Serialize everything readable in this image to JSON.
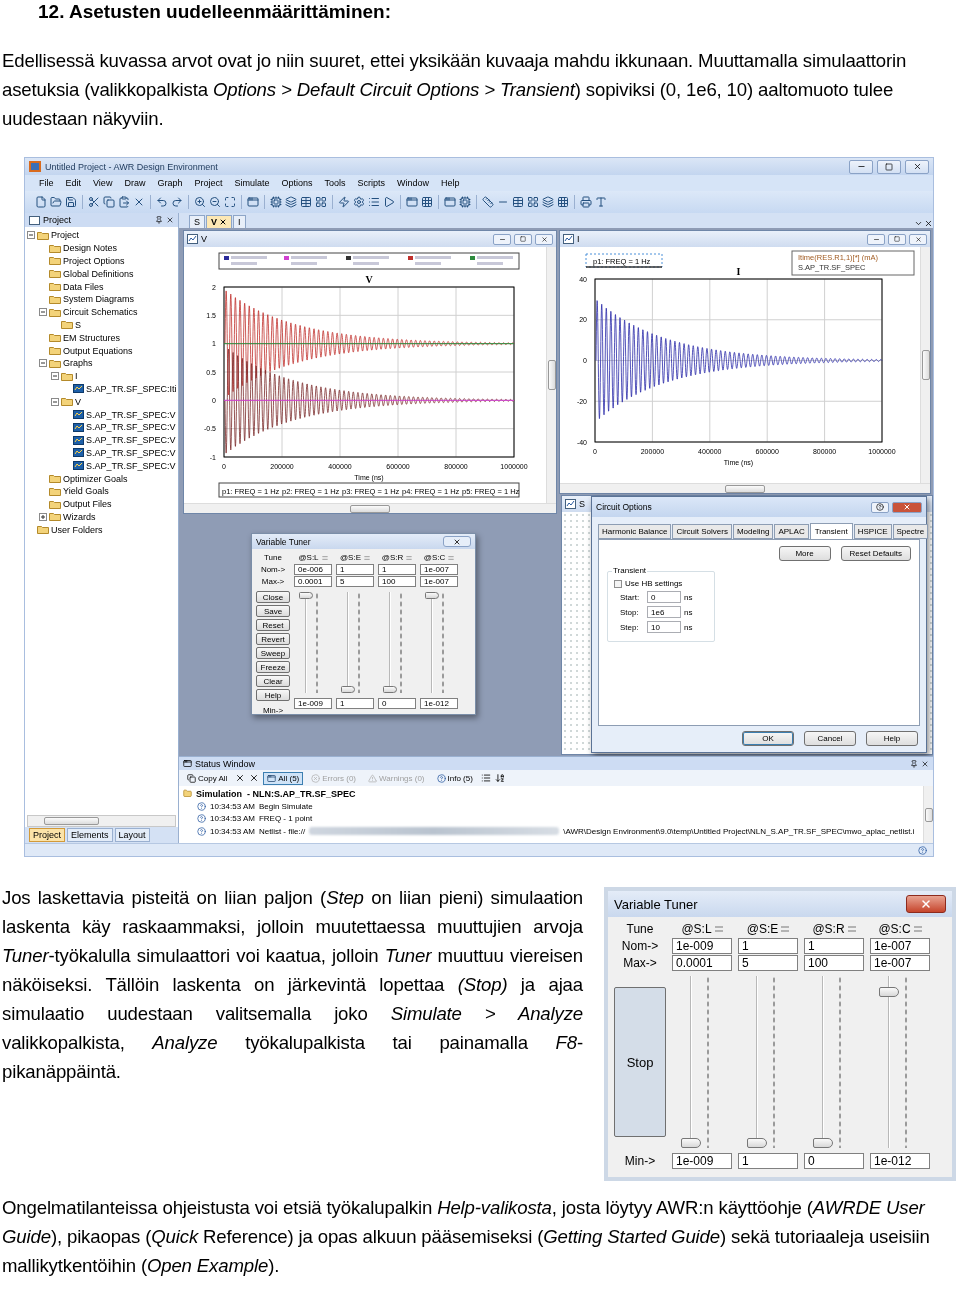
{
  "heading": "12. Asetusten uudelleenmäärittäminen:",
  "intro": "Edellisessä kuvassa arvot ovat jo niin suuret, ettei yksikään kuvaaja mahdu ikkunaan. Muuttamalla simulaattorin asetuksia (valikkopalkista *Options > Default Circuit Options > Transient*) sopiviksi (0, 1e6, 10) aaltomuoto tulee uudestaan näkyviin.",
  "app": {
    "title": "Untitled Project - AWR Design Environment",
    "menu": [
      "File",
      "Edit",
      "View",
      "Draw",
      "Graph",
      "Project",
      "Simulate",
      "Options",
      "Tools",
      "Scripts",
      "Window",
      "Help"
    ],
    "project_pane": {
      "title": "Project",
      "tree": [
        {
          "label": "Project",
          "expanded": true,
          "children": [
            {
              "label": "Design Notes"
            },
            {
              "label": "Project Options"
            },
            {
              "label": "Global Definitions"
            },
            {
              "label": "Data Files"
            },
            {
              "label": "System Diagrams"
            },
            {
              "label": "Circuit Schematics",
              "expanded": true,
              "children": [
                {
                  "label": "S"
                }
              ]
            },
            {
              "label": "EM Structures"
            },
            {
              "label": "Output Equations"
            },
            {
              "label": "Graphs",
              "expanded": true,
              "children": [
                {
                  "label": "I",
                  "expanded": true,
                  "children": [
                    {
                      "label": "S.AP_TR.SF_SPEC:Iti"
                    }
                  ]
                },
                {
                  "label": "V",
                  "expanded": true,
                  "children": [
                    {
                      "label": "S.AP_TR.SF_SPEC:V"
                    },
                    {
                      "label": "S.AP_TR.SF_SPEC:V"
                    },
                    {
                      "label": "S.AP_TR.SF_SPEC:V"
                    },
                    {
                      "label": "S.AP_TR.SF_SPEC:V"
                    },
                    {
                      "label": "S.AP_TR.SF_SPEC:V"
                    }
                  ]
                }
              ]
            },
            {
              "label": "Optimizer Goals"
            },
            {
              "label": "Yield Goals"
            },
            {
              "label": "Output Files"
            },
            {
              "label": "Wizards",
              "expanded": false
            }
          ]
        },
        {
          "label": "User Folders"
        }
      ],
      "tabs": [
        {
          "label": "Project",
          "selected": true
        },
        {
          "label": "Elements",
          "selected": false
        },
        {
          "label": "Layout",
          "selected": false
        }
      ]
    },
    "document_tabs": [
      {
        "label": "S",
        "selected": false
      },
      {
        "label": "V",
        "selected": true
      },
      {
        "label": "I",
        "selected": false
      }
    ],
    "graphs": [
      {
        "kind": "multi",
        "window_title": "V",
        "title": "V",
        "y_ticks": [
          "2",
          "1.5",
          "1",
          "0.5",
          "0",
          "-0.5",
          "-1"
        ],
        "x_ticks": [
          "0",
          "200000",
          "400000",
          "600000",
          "800000",
          "1000000"
        ],
        "x_label": "Time (ns)",
        "markers": [
          "p1: FREQ = 1 Hz",
          "p2: FREQ = 1 Hz",
          "p3: FREQ = 1 Hz",
          "p4: FREQ = 1 Hz",
          "p5: FREQ = 1 Hz"
        ]
      },
      {
        "kind": "single",
        "window_title": "I",
        "title": "I",
        "y_ticks": [
          "40",
          "20",
          "0",
          "-20",
          "-40"
        ],
        "x_ticks": [
          "0",
          "200000",
          "400000",
          "600000",
          "800000",
          "1000000"
        ],
        "x_label": "Time (ns)",
        "markers": [
          "p1: FREQ = 1 Hz"
        ],
        "legend": [
          "Itime(RES.R1,1)[*] (mA)",
          "S.AP_TR.SF_SPEC"
        ]
      }
    ],
    "schematic_window": {
      "title": "S"
    },
    "circuit_options": {
      "title": "Circuit Options",
      "tabs": [
        {
          "label": "Harmonic Balance",
          "selected": false
        },
        {
          "label": "Circuit Solvers",
          "selected": false
        },
        {
          "label": "Modeling",
          "selected": false
        },
        {
          "label": "APLAC",
          "selected": false
        },
        {
          "label": "Transient",
          "selected": true
        },
        {
          "label": "HSPICE",
          "selected": false
        },
        {
          "label": "Spectre",
          "selected": false
        }
      ],
      "more": "More",
      "reset": "Reset Defaults",
      "group": "Transient",
      "use_hb_settings": {
        "label": "Use HB settings",
        "checked": false
      },
      "fields": [
        {
          "label": "Start:",
          "value": "0",
          "unit": "ns"
        },
        {
          "label": "Stop:",
          "value": "1e6",
          "unit": "ns"
        },
        {
          "label": "Step:",
          "value": "10",
          "unit": "ns"
        }
      ],
      "buttons": [
        "OK",
        "Cancel",
        "Help"
      ]
    },
    "tuner": {
      "title": "Variable Tuner",
      "labels": [
        "Tune",
        "Nom->",
        "Max->",
        "Min->"
      ],
      "buttons": [
        "Close",
        "Save",
        "Reset",
        "Revert",
        "Sweep",
        "Freeze",
        "Clear",
        "Help"
      ],
      "vars": [
        {
          "name": "@S:L",
          "nom": "0e-006",
          "max": "0.0001",
          "min": "1e-009",
          "level": 1
        },
        {
          "name": "@S:E",
          "nom": "1",
          "max": "5",
          "min": "1",
          "level": 0
        },
        {
          "name": "@S:R",
          "nom": "1",
          "max": "100",
          "min": "0",
          "level": 0
        },
        {
          "name": "@S:C",
          "nom": "1e-007",
          "max": "1e-007",
          "min": "1e-012",
          "level": 1
        }
      ]
    },
    "status_window": {
      "title": "Status Window",
      "copy_all": "Copy All",
      "filters": [
        {
          "label": "All (5)",
          "selected": true,
          "disabled": false
        },
        {
          "label": "Errors (0)",
          "selected": false,
          "disabled": true
        },
        {
          "label": "Warnings (0)",
          "selected": false,
          "disabled": true
        },
        {
          "label": "Info (5)",
          "selected": false,
          "disabled": false
        }
      ],
      "group": "Simulation  - NLN:S.AP_TR.SF_SPEC",
      "entries": [
        {
          "time": "10:34:53 AM",
          "message": "Begin Simulate",
          "redacted": false
        },
        {
          "time": "10:34:53 AM",
          "message": "FREQ - 1 point",
          "redacted": false
        },
        {
          "time": "10:34:53 AM",
          "message": "Netlist - file://",
          "redacted": true,
          "message_end": "\\AWR\\Design Environment\\9.0\\temp\\Untitled Project\\NLN_S.AP_TR.SF_SPEC\\mwo_aplac_netlist.i"
        }
      ]
    }
  },
  "paragraph_2": "Jos laskettavia pisteitä on liian paljon (*Step* on liian pieni) simulaation laskenta käy raskaammaksi, jolloin muutettaessa muuttujien arvoja *Tuner*-työkalulla simulaattori voi kaatua, jolloin *Tuner* muuttuu viereisen näköiseksi. Tällöin laskenta on järkevintä lopettaa *(Stop)* ja ajaa simulaatio uudestaan valitsemalla joko *Simulate > Analyze* valikkopalkista, *Analyze* työkalupalkista tai painamalla *F8*-pikanäppäintä.",
  "tuner_2": {
    "title": "Variable Tuner",
    "labels": [
      "Tune",
      "Nom->",
      "Max->",
      "Min->"
    ],
    "buttons": [
      "Stop"
    ],
    "vars": [
      {
        "name": "@S:L",
        "nom": "1e-009",
        "max": "0.0001",
        "min": "1e-009",
        "level": 0
      },
      {
        "name": "@S:E",
        "nom": "1",
        "max": "5",
        "min": "1",
        "level": 0
      },
      {
        "name": "@S:R",
        "nom": "1",
        "max": "100",
        "min": "0",
        "level": 0
      },
      {
        "name": "@S:C",
        "nom": "1e-007",
        "max": "1e-007",
        "min": "1e-012",
        "level": 0.93
      }
    ]
  },
  "paragraph_3": "Ongelmatilanteissa ohjeistusta voi etsiä työkalupalkin *Help-valikosta*, josta löytyy AWR:n käyttöohje (*AWRDE User Guide*), pikaopas (*Quick* Reference) ja opas alkuun pääsemiseksi (*Getting Started Guide*) sekä tutoriaaleja useisiin mallikytkentöihin (*Open Example*)."
}
